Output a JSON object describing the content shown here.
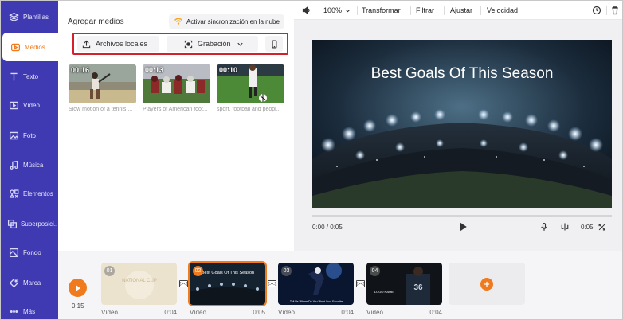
{
  "sidebar": {
    "items": [
      {
        "label": "Plantillas",
        "icon": "layers-icon"
      },
      {
        "label": "Medios",
        "icon": "media-icon",
        "active": true
      },
      {
        "label": "Texto",
        "icon": "text-icon"
      },
      {
        "label": "Vídeo",
        "icon": "video-icon"
      },
      {
        "label": "Foto",
        "icon": "photo-icon"
      },
      {
        "label": "Música",
        "icon": "music-icon"
      },
      {
        "label": "Elementos",
        "icon": "elements-icon"
      },
      {
        "label": "Superposici...",
        "icon": "overlay-icon"
      },
      {
        "label": "Fondo",
        "icon": "background-icon"
      },
      {
        "label": "Marca",
        "icon": "brand-icon"
      },
      {
        "label": "Más",
        "icon": "more-icon"
      }
    ]
  },
  "media_panel": {
    "title": "Agregar medios",
    "cloud_sync_label": "Activar sincronización en la nube",
    "local_files_label": "Archivos locales",
    "recording_label": "Grabación",
    "thumbnails": [
      {
        "duration": "00:16",
        "caption": "Slow motion of a tennis ..."
      },
      {
        "duration": "00:13",
        "caption": "Players of American foot..."
      },
      {
        "duration": "00:10",
        "caption": "sport, football and peopl..."
      }
    ]
  },
  "toolbar": {
    "zoom": "100%",
    "transform": "Transformar",
    "filter": "Filtrar",
    "adjust": "Ajustar",
    "speed": "Velocidad"
  },
  "preview": {
    "title": "Best Goals Of This Season",
    "time": "0:00 / 0:05",
    "duration_right": "0:05"
  },
  "timeline": {
    "current_time": "0:15",
    "clips": [
      {
        "num": "01",
        "type": "Vídeo",
        "duration": "0:04",
        "text": "NATIONAL CUP"
      },
      {
        "num": "02",
        "type": "Vídeo",
        "duration": "0:05",
        "text": "Best Goals Of This Season"
      },
      {
        "num": "03",
        "type": "Vídeo",
        "duration": "0:04",
        "text": "Tell Us Whom Do You Want Your Favorite"
      },
      {
        "num": "04",
        "type": "Vídeo",
        "duration": "0:04",
        "text": "LOGO NAME"
      }
    ]
  },
  "colors": {
    "sidebar": "#3f3ab1",
    "accent": "#f07a1e",
    "highlight_box": "#d3202a"
  }
}
